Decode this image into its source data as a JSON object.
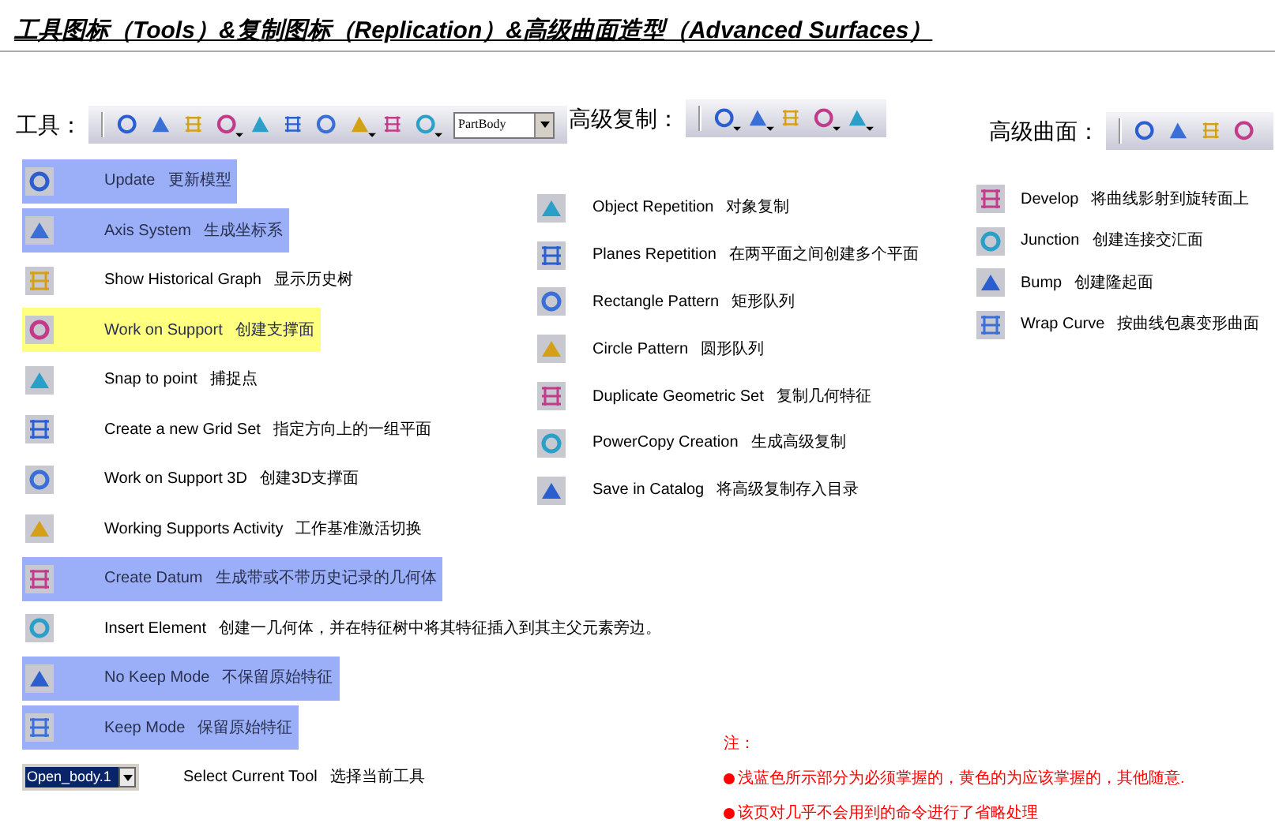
{
  "title": "工具图标（Tools）&复制图标（Replication）&高级曲面造型（Advanced Surfaces）",
  "sections": [
    {
      "label": "工具：",
      "toolbar": [
        {
          "has_menu": false
        },
        {
          "has_menu": false
        },
        {
          "has_menu": false
        },
        {
          "has_menu": true
        },
        {
          "has_menu": false
        },
        {
          "has_menu": false
        },
        {
          "has_menu": false
        },
        {
          "has_menu": true
        },
        {
          "has_menu": false
        },
        {
          "has_menu": true
        }
      ],
      "toolbar_dropdown": "PartBody",
      "rows": [
        {
          "kind": "icon",
          "name": "Update",
          "desc": "更新模型",
          "color": "#9aaff8"
        },
        {
          "kind": "icon",
          "name": "Axis System",
          "desc": "生成坐标系",
          "color": "#9aaff8"
        },
        {
          "kind": "icon",
          "name": "Show Historical Graph",
          "desc": "显示历史树"
        },
        {
          "kind": "icon",
          "name": "Work on Support",
          "desc": "创建支撑面",
          "color": "#ffff80"
        },
        {
          "kind": "icon",
          "name": "Snap to point",
          "desc": "捕捉点"
        },
        {
          "kind": "icon",
          "name": "Create a new Grid Set",
          "desc": "指定方向上的一组平面"
        },
        {
          "kind": "icon",
          "name": "Work on Support 3D",
          "desc": "创建3D支撑面"
        },
        {
          "kind": "icon",
          "name": "Working Supports Activity",
          "desc": "工作基准激活切换"
        },
        {
          "kind": "icon",
          "name": "Create Datum",
          "desc": "生成带或不带历史记录的几何体",
          "color": "#9aaff8"
        },
        {
          "kind": "icon",
          "name": "Insert Element",
          "desc": "创建一几何体，并在特征树中将其特征插入到其主父元素旁边。"
        },
        {
          "kind": "icon",
          "name": "No Keep Mode",
          "desc": "不保留原始特征",
          "color": "#9aaff8"
        },
        {
          "kind": "icon",
          "name": "Keep Mode",
          "desc": "保留原始特征",
          "color": "#9aaff8"
        },
        {
          "kind": "dropdown",
          "value": "Open_body.1",
          "name": "Select Current Tool",
          "desc": "选择当前工具"
        }
      ]
    },
    {
      "label": "高级复制：",
      "toolbar": [
        {
          "has_menu": true
        },
        {
          "has_menu": true
        },
        {
          "has_menu": false
        },
        {
          "has_menu": true
        },
        {
          "has_menu": true
        }
      ],
      "rows": [
        {
          "kind": "icon",
          "name": "Object Repetition",
          "desc": "对象复制"
        },
        {
          "kind": "icon",
          "name": "Planes Repetition",
          "desc": "在两平面之间创建多个平面"
        },
        {
          "kind": "icon",
          "name": "Rectangle Pattern",
          "desc": "矩形队列"
        },
        {
          "kind": "icon",
          "name": "Circle Pattern",
          "desc": "圆形队列"
        },
        {
          "kind": "icon",
          "name": "Duplicate Geometric Set",
          "desc": "复制几何特征"
        },
        {
          "kind": "icon",
          "name": "PowerCopy Creation",
          "desc": "生成高级复制"
        },
        {
          "kind": "icon",
          "name": "Save in Catalog",
          "desc": "将高级复制存入目录"
        }
      ]
    },
    {
      "label": "高级曲面：",
      "toolbar": [
        {
          "has_menu": false
        },
        {
          "has_menu": false
        },
        {
          "has_menu": false
        },
        {
          "has_menu": false
        }
      ],
      "rows": [
        {
          "kind": "icon",
          "name": "Develop",
          "desc": "将曲线影射到旋转面上"
        },
        {
          "kind": "icon",
          "name": "Junction",
          "desc": "创建连接交汇面"
        },
        {
          "kind": "icon",
          "name": "Bump",
          "desc": "创建隆起面"
        },
        {
          "kind": "icon",
          "name": "Wrap Curve",
          "desc": "按曲线包裹变形曲面"
        }
      ]
    }
  ],
  "notes": {
    "heading": "注：",
    "items": [
      "浅蓝色所示部分为必须掌握的，黄色的为应该掌握的，其他随意.",
      "该页对几乎不会用到的命令进行了省略处理"
    ]
  }
}
